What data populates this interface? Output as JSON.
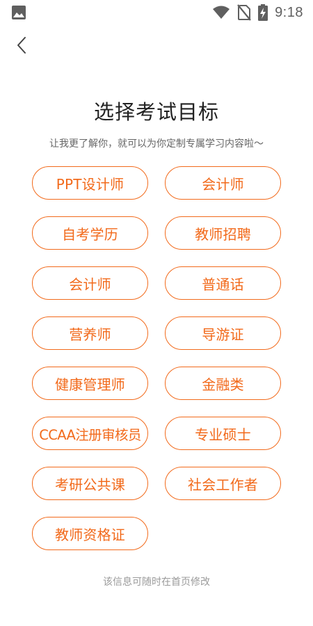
{
  "status_bar": {
    "time": "9:18",
    "icons": [
      "image-notification-icon",
      "wifi-icon",
      "no-sim-icon",
      "battery-charging-icon"
    ]
  },
  "header": {
    "back_icon": "chevron-left-icon",
    "title": "选择考试目标",
    "subtitle": "让我更了解你，就可以为你定制专属学习内容啦～"
  },
  "options": [
    {
      "label": "PPT设计师"
    },
    {
      "label": "会计师"
    },
    {
      "label": "自考学历"
    },
    {
      "label": "教师招聘"
    },
    {
      "label": "会计师"
    },
    {
      "label": "普通话"
    },
    {
      "label": "营养师"
    },
    {
      "label": "导游证"
    },
    {
      "label": "健康管理师"
    },
    {
      "label": "金融类"
    },
    {
      "label": "CCAA注册审核员"
    },
    {
      "label": "专业硕士"
    },
    {
      "label": "考研公共课"
    },
    {
      "label": "社会工作者"
    },
    {
      "label": "教师资格证"
    }
  ],
  "footer": {
    "note": "该信息可随时在首页修改"
  },
  "colors": {
    "accent": "#f26a1b",
    "title": "#222222",
    "subtitle": "#666666",
    "footer": "#9a9a9a"
  }
}
